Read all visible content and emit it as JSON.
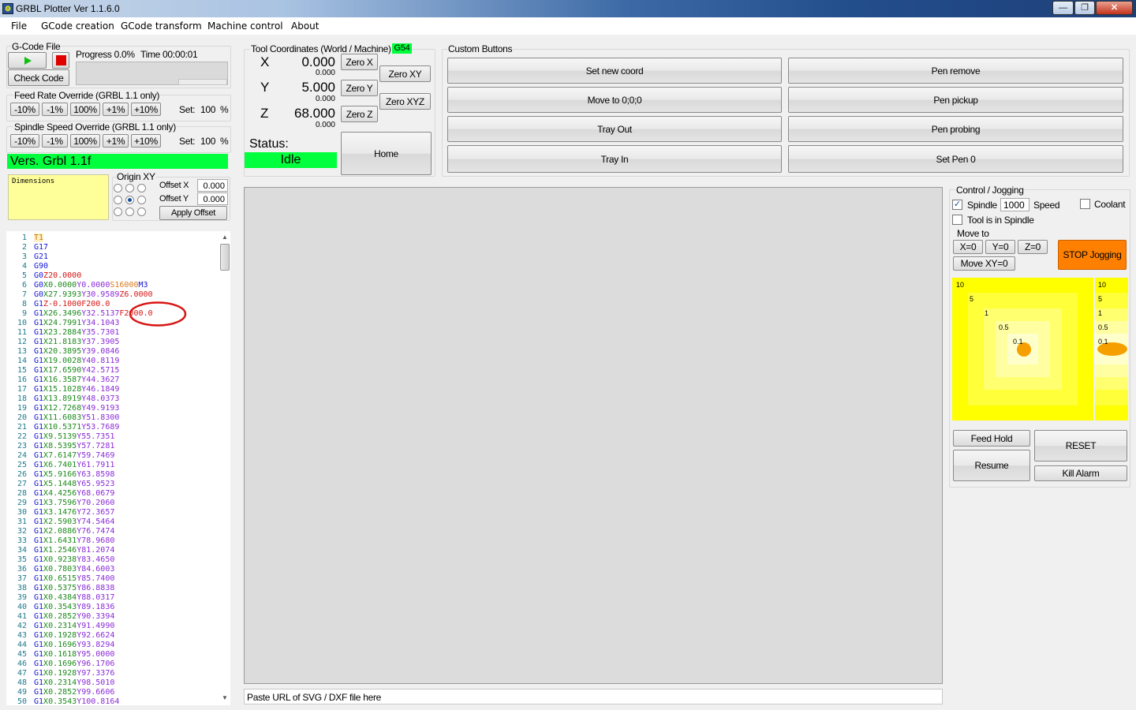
{
  "window": {
    "title": "GRBL Plotter Ver 1.1.6.0",
    "icon": "app-logo-icon",
    "buttons": {
      "minimize": "—",
      "maximize": "❐",
      "close": "✕"
    }
  },
  "menu": [
    "File",
    "GCode creation",
    "GCode transform",
    "Machine control",
    "About"
  ],
  "gcode_file": {
    "group_label": "G-Code File",
    "play_icon": "play-icon",
    "stop_icon": "stop-icon",
    "check_code": "Check Code",
    "progress_label": "Progress 0.0%",
    "time_label": "Time 00:00:01",
    "progress_value": 0.0
  },
  "feed_override": {
    "label": "Feed Rate Override (GRBL 1.1 only)",
    "buttons": [
      "-10%",
      "-1%",
      "100%",
      "+1%",
      "+10%"
    ],
    "set_label": "Set:",
    "set_value": "100",
    "unit": "%"
  },
  "spindle_override": {
    "label": "Spindle Speed Override (GRBL 1.1 only)",
    "buttons": [
      "-10%",
      "-1%",
      "100%",
      "+1%",
      "+10%"
    ],
    "set_label": "Set:",
    "set_value": "100",
    "unit": "%"
  },
  "version": "Vers. Grbl 1.1f",
  "dimensions_label": "Dimensions",
  "origin": {
    "label": "Origin XY",
    "selected": "center",
    "offset_x_label": "Offset X",
    "offset_x": "0.000",
    "offset_y_label": "Offset Y",
    "offset_y": "0.000",
    "apply": "Apply Offset"
  },
  "tool_coords": {
    "label": "Tool Coordinates (World / Machine)",
    "wcs": "G54",
    "axes": [
      {
        "name": "X",
        "world": "0.000",
        "machine": "0.000",
        "zero": "Zero X"
      },
      {
        "name": "Y",
        "world": "5.000",
        "machine": "0.000",
        "zero": "Zero Y"
      },
      {
        "name": "Z",
        "world": "68.000",
        "machine": "0.000",
        "zero": "Zero Z"
      }
    ],
    "zero_xy": "Zero XY",
    "zero_xyz": "Zero XYZ",
    "status_label": "Status:",
    "status": "Idle",
    "home": "Home"
  },
  "custom_buttons": {
    "label": "Custom Buttons",
    "left": [
      "Set new coord",
      "Move to 0;0;0",
      "Tray Out",
      "Tray In"
    ],
    "right": [
      "Pen remove",
      "Pen pickup",
      "Pen probing",
      "Set Pen 0"
    ]
  },
  "control": {
    "label": "Control / Jogging",
    "spindle_label": "Spindle",
    "spindle_checked": true,
    "speed_value": "1000",
    "speed_label": "Speed",
    "coolant_label": "Coolant",
    "coolant_checked": false,
    "tool_in_spindle_label": "Tool is in Spindle",
    "tool_in_spindle_checked": false,
    "move_to_label": "Move to",
    "x0": "X=0",
    "y0": "Y=0",
    "z0": "Z=0",
    "move_xy0": "Move XY=0",
    "stop_jogging": "STOP Jogging",
    "jog_xy_labels": [
      "10",
      "5",
      "1",
      "0.5",
      "0.1"
    ],
    "jog_z_labels": [
      "10",
      "5",
      "1",
      "0.5",
      "0.1"
    ],
    "feed_hold": "Feed Hold",
    "reset": "RESET",
    "resume": "Resume",
    "kill_alarm": "Kill Alarm",
    "jog_color": "#ffff00",
    "stop_color": "#ff8000"
  },
  "path_hint": "Paste URL of SVG / DXF file here",
  "gcode_lines": [
    [
      [
        "#c87800",
        "T1"
      ]
    ],
    [
      [
        "#1515d8",
        "G17"
      ]
    ],
    [
      [
        "#1515d8",
        "G21"
      ]
    ],
    [
      [
        "#1515d8",
        "G90"
      ]
    ],
    [
      [
        "#1515d8",
        "G0"
      ],
      [
        "#d81515",
        "Z20.0000"
      ]
    ],
    [
      [
        "#1515d8",
        "G0"
      ],
      [
        "#1b8a1b",
        "X0.0000"
      ],
      [
        "#8a2ad8",
        "Y0.0000"
      ],
      [
        "#d87a1b",
        "S16000"
      ],
      [
        "#1515d8",
        "M3"
      ]
    ],
    [
      [
        "#1515d8",
        "G0"
      ],
      [
        "#1b8a1b",
        "X27.9393"
      ],
      [
        "#8a2ad8",
        "Y30.9589"
      ],
      [
        "#d81515",
        "Z6.0000"
      ]
    ],
    [
      [
        "#1515d8",
        "G1"
      ],
      [
        "#d81515",
        "Z-0.1000"
      ],
      [
        "#d81515",
        "F200.0"
      ]
    ],
    [
      [
        "#1515d8",
        "G1"
      ],
      [
        "#1b8a1b",
        "X26.3496"
      ],
      [
        "#8a2ad8",
        "Y32.5137"
      ],
      [
        "#d81515",
        "F2000.0"
      ]
    ],
    [
      [
        "#1515d8",
        "G1"
      ],
      [
        "#1b8a1b",
        "X24.7991"
      ],
      [
        "#8a2ad8",
        "Y34.1043"
      ]
    ],
    [
      [
        "#1515d8",
        "G1"
      ],
      [
        "#1b8a1b",
        "X23.2884"
      ],
      [
        "#8a2ad8",
        "Y35.7301"
      ]
    ],
    [
      [
        "#1515d8",
        "G1"
      ],
      [
        "#1b8a1b",
        "X21.8183"
      ],
      [
        "#8a2ad8",
        "Y37.3905"
      ]
    ],
    [
      [
        "#1515d8",
        "G1"
      ],
      [
        "#1b8a1b",
        "X20.3895"
      ],
      [
        "#8a2ad8",
        "Y39.0846"
      ]
    ],
    [
      [
        "#1515d8",
        "G1"
      ],
      [
        "#1b8a1b",
        "X19.0028"
      ],
      [
        "#8a2ad8",
        "Y40.8119"
      ]
    ],
    [
      [
        "#1515d8",
        "G1"
      ],
      [
        "#1b8a1b",
        "X17.6590"
      ],
      [
        "#8a2ad8",
        "Y42.5715"
      ]
    ],
    [
      [
        "#1515d8",
        "G1"
      ],
      [
        "#1b8a1b",
        "X16.3587"
      ],
      [
        "#8a2ad8",
        "Y44.3627"
      ]
    ],
    [
      [
        "#1515d8",
        "G1"
      ],
      [
        "#1b8a1b",
        "X15.1028"
      ],
      [
        "#8a2ad8",
        "Y46.1849"
      ]
    ],
    [
      [
        "#1515d8",
        "G1"
      ],
      [
        "#1b8a1b",
        "X13.8919"
      ],
      [
        "#8a2ad8",
        "Y48.0373"
      ]
    ],
    [
      [
        "#1515d8",
        "G1"
      ],
      [
        "#1b8a1b",
        "X12.7268"
      ],
      [
        "#8a2ad8",
        "Y49.9193"
      ]
    ],
    [
      [
        "#1515d8",
        "G1"
      ],
      [
        "#1b8a1b",
        "X11.6083"
      ],
      [
        "#8a2ad8",
        "Y51.8300"
      ]
    ],
    [
      [
        "#1515d8",
        "G1"
      ],
      [
        "#1b8a1b",
        "X10.5371"
      ],
      [
        "#8a2ad8",
        "Y53.7689"
      ]
    ],
    [
      [
        "#1515d8",
        "G1"
      ],
      [
        "#1b8a1b",
        "X9.5139"
      ],
      [
        "#8a2ad8",
        "Y55.7351"
      ]
    ],
    [
      [
        "#1515d8",
        "G1"
      ],
      [
        "#1b8a1b",
        "X8.5395"
      ],
      [
        "#8a2ad8",
        "Y57.7281"
      ]
    ],
    [
      [
        "#1515d8",
        "G1"
      ],
      [
        "#1b8a1b",
        "X7.6147"
      ],
      [
        "#8a2ad8",
        "Y59.7469"
      ]
    ],
    [
      [
        "#1515d8",
        "G1"
      ],
      [
        "#1b8a1b",
        "X6.7401"
      ],
      [
        "#8a2ad8",
        "Y61.7911"
      ]
    ],
    [
      [
        "#1515d8",
        "G1"
      ],
      [
        "#1b8a1b",
        "X5.9166"
      ],
      [
        "#8a2ad8",
        "Y63.8598"
      ]
    ],
    [
      [
        "#1515d8",
        "G1"
      ],
      [
        "#1b8a1b",
        "X5.1448"
      ],
      [
        "#8a2ad8",
        "Y65.9523"
      ]
    ],
    [
      [
        "#1515d8",
        "G1"
      ],
      [
        "#1b8a1b",
        "X4.4256"
      ],
      [
        "#8a2ad8",
        "Y68.0679"
      ]
    ],
    [
      [
        "#1515d8",
        "G1"
      ],
      [
        "#1b8a1b",
        "X3.7596"
      ],
      [
        "#8a2ad8",
        "Y70.2060"
      ]
    ],
    [
      [
        "#1515d8",
        "G1"
      ],
      [
        "#1b8a1b",
        "X3.1476"
      ],
      [
        "#8a2ad8",
        "Y72.3657"
      ]
    ],
    [
      [
        "#1515d8",
        "G1"
      ],
      [
        "#1b8a1b",
        "X2.5903"
      ],
      [
        "#8a2ad8",
        "Y74.5464"
      ]
    ],
    [
      [
        "#1515d8",
        "G1"
      ],
      [
        "#1b8a1b",
        "X2.0886"
      ],
      [
        "#8a2ad8",
        "Y76.7474"
      ]
    ],
    [
      [
        "#1515d8",
        "G1"
      ],
      [
        "#1b8a1b",
        "X1.6431"
      ],
      [
        "#8a2ad8",
        "Y78.9680"
      ]
    ],
    [
      [
        "#1515d8",
        "G1"
      ],
      [
        "#1b8a1b",
        "X1.2546"
      ],
      [
        "#8a2ad8",
        "Y81.2074"
      ]
    ],
    [
      [
        "#1515d8",
        "G1"
      ],
      [
        "#1b8a1b",
        "X0.9238"
      ],
      [
        "#8a2ad8",
        "Y83.4650"
      ]
    ],
    [
      [
        "#1515d8",
        "G1"
      ],
      [
        "#1b8a1b",
        "X0.7803"
      ],
      [
        "#8a2ad8",
        "Y84.6003"
      ]
    ],
    [
      [
        "#1515d8",
        "G1"
      ],
      [
        "#1b8a1b",
        "X0.6515"
      ],
      [
        "#8a2ad8",
        "Y85.7400"
      ]
    ],
    [
      [
        "#1515d8",
        "G1"
      ],
      [
        "#1b8a1b",
        "X0.5375"
      ],
      [
        "#8a2ad8",
        "Y86.8838"
      ]
    ],
    [
      [
        "#1515d8",
        "G1"
      ],
      [
        "#1b8a1b",
        "X0.4384"
      ],
      [
        "#8a2ad8",
        "Y88.0317"
      ]
    ],
    [
      [
        "#1515d8",
        "G1"
      ],
      [
        "#1b8a1b",
        "X0.3543"
      ],
      [
        "#8a2ad8",
        "Y89.1836"
      ]
    ],
    [
      [
        "#1515d8",
        "G1"
      ],
      [
        "#1b8a1b",
        "X0.2852"
      ],
      [
        "#8a2ad8",
        "Y90.3394"
      ]
    ],
    [
      [
        "#1515d8",
        "G1"
      ],
      [
        "#1b8a1b",
        "X0.2314"
      ],
      [
        "#8a2ad8",
        "Y91.4990"
      ]
    ],
    [
      [
        "#1515d8",
        "G1"
      ],
      [
        "#1b8a1b",
        "X0.1928"
      ],
      [
        "#8a2ad8",
        "Y92.6624"
      ]
    ],
    [
      [
        "#1515d8",
        "G1"
      ],
      [
        "#1b8a1b",
        "X0.1696"
      ],
      [
        "#8a2ad8",
        "Y93.8294"
      ]
    ],
    [
      [
        "#1515d8",
        "G1"
      ],
      [
        "#1b8a1b",
        "X0.1618"
      ],
      [
        "#8a2ad8",
        "Y95.0000"
      ]
    ],
    [
      [
        "#1515d8",
        "G1"
      ],
      [
        "#1b8a1b",
        "X0.1696"
      ],
      [
        "#8a2ad8",
        "Y96.1706"
      ]
    ],
    [
      [
        "#1515d8",
        "G1"
      ],
      [
        "#1b8a1b",
        "X0.1928"
      ],
      [
        "#8a2ad8",
        "Y97.3376"
      ]
    ],
    [
      [
        "#1515d8",
        "G1"
      ],
      [
        "#1b8a1b",
        "X0.2314"
      ],
      [
        "#8a2ad8",
        "Y98.5010"
      ]
    ],
    [
      [
        "#1515d8",
        "G1"
      ],
      [
        "#1b8a1b",
        "X0.2852"
      ],
      [
        "#8a2ad8",
        "Y99.6606"
      ]
    ],
    [
      [
        "#1515d8",
        "G1"
      ],
      [
        "#1b8a1b",
        "X0.3543"
      ],
      [
        "#8a2ad8",
        "Y100.8164"
      ]
    ]
  ]
}
